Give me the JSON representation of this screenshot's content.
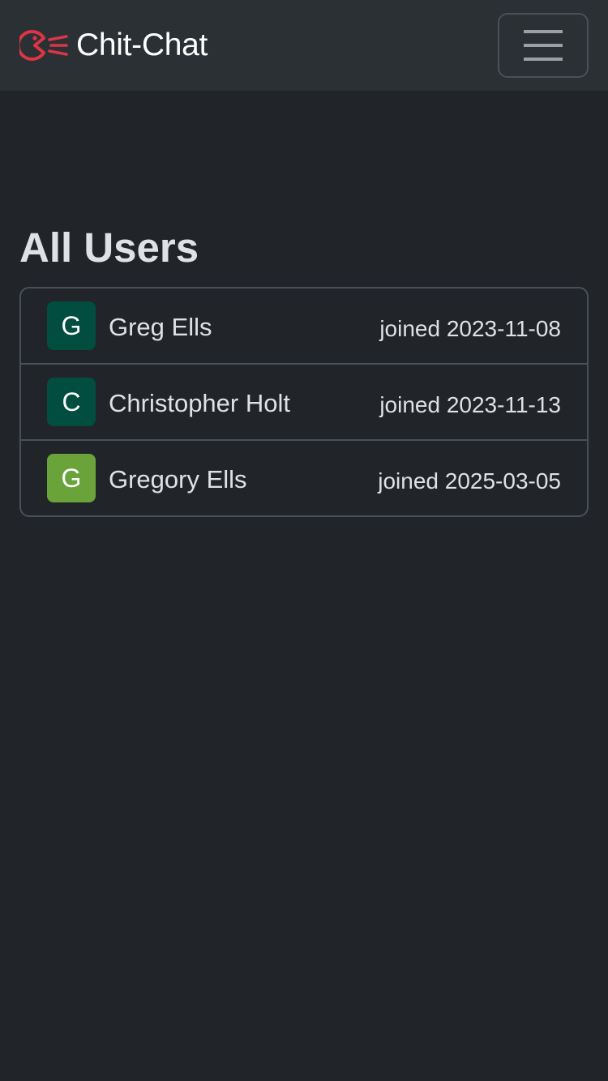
{
  "navbar": {
    "brand_name": "Chit-Chat",
    "brand_logo_icon": "chat-mouth-logo-icon",
    "brand_color": "#dc3545",
    "menu_icon": "hamburger-menu-icon"
  },
  "page": {
    "title": "All Users"
  },
  "users": [
    {
      "initial": "G",
      "name": "Greg Ells",
      "joined": "joined 2023-11-08",
      "avatar_color": "#014d40"
    },
    {
      "initial": "C",
      "name": "Christopher Holt",
      "joined": "joined 2023-11-13",
      "avatar_color": "#014d40"
    },
    {
      "initial": "G",
      "name": "Gregory Ells",
      "joined": "joined 2025-03-05",
      "avatar_color": "#6aa33a"
    }
  ]
}
